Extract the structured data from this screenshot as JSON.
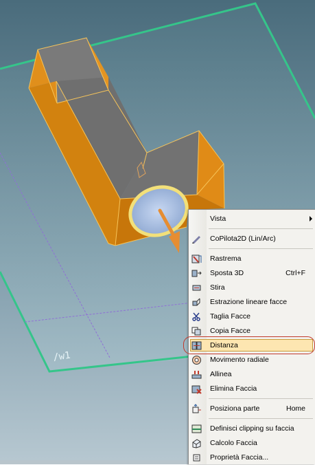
{
  "viewport": {
    "label": "/w1",
    "colors": {
      "background_top": "#4d6f80",
      "background_bottom": "#a9bdc8",
      "plane_edge": "#35c58a",
      "part_face": "#767676",
      "part_side": "#d98a14",
      "part_edge": "#f6c45a",
      "ring": "#f2e07a",
      "arrow": "#e68d32",
      "guide_line": "#8f6fd6"
    }
  },
  "context_menu": {
    "items": [
      {
        "label": "Vista",
        "icon": "none",
        "submenu": true
      },
      {
        "separator": true
      },
      {
        "label": "CoPilota2D (Lin/Arc)",
        "icon": "copilot-pen-icon"
      },
      {
        "separator": true
      },
      {
        "label": "Rastrema",
        "icon": "taper-icon"
      },
      {
        "label": "Sposta 3D",
        "icon": "move-3d-icon",
        "shortcut": "Ctrl+F"
      },
      {
        "label": "Stira",
        "icon": "stretch-icon"
      },
      {
        "label": "Estrazione lineare facce",
        "icon": "extrude-faces-icon"
      },
      {
        "label": "Taglia Facce",
        "icon": "cut-faces-icon"
      },
      {
        "label": "Copia Facce",
        "icon": "copy-faces-icon"
      },
      {
        "label": "Distanza",
        "icon": "distance-icon",
        "highlighted": true
      },
      {
        "label": "Movimento radiale",
        "icon": "radial-move-icon"
      },
      {
        "label": "Allinea",
        "icon": "align-icon"
      },
      {
        "label": "Elimina Faccia",
        "icon": "delete-face-icon"
      },
      {
        "separator": true
      },
      {
        "label": "Posiziona parte",
        "icon": "position-part-icon",
        "shortcut": "Home"
      },
      {
        "separator": true
      },
      {
        "label": "Definisci clipping su faccia",
        "icon": "clipping-icon"
      },
      {
        "label": "Calcolo Faccia",
        "icon": "face-calc-icon"
      },
      {
        "label": "Proprietà Faccia...",
        "icon": "face-properties-icon"
      }
    ]
  }
}
